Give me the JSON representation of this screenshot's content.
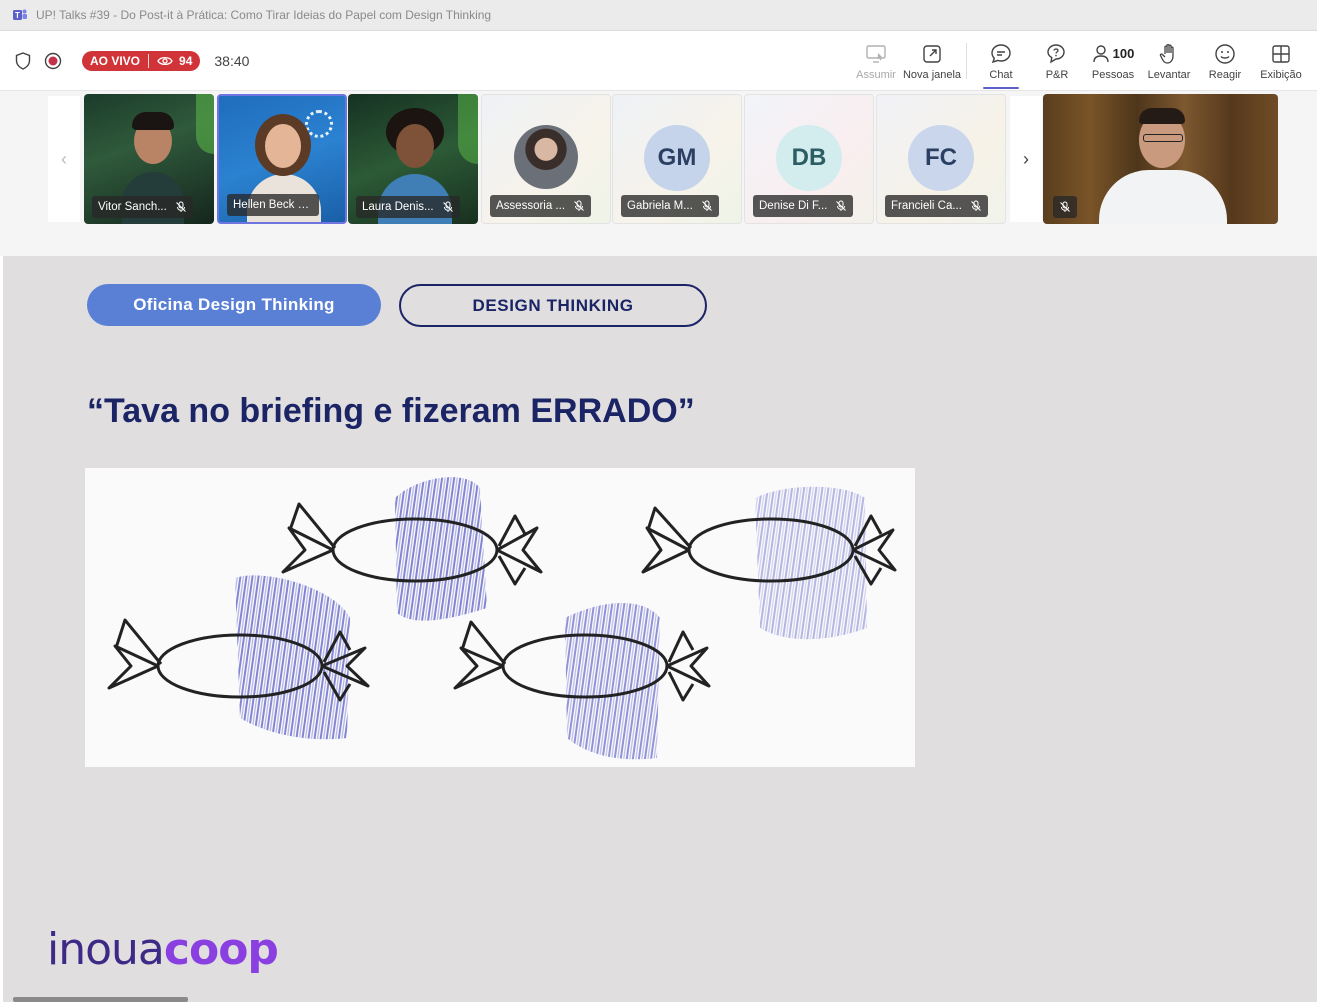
{
  "window": {
    "title": "UP! Talks #39 - Do Post-it à Prática: Como Tirar Ideias do Papel com Design Thinking",
    "app_icon": "teams-icon"
  },
  "toolbar": {
    "live_label": "AO VIVO",
    "viewers": "94",
    "timer": "38:40",
    "buttons": {
      "assumir": "Assumir",
      "nova_janela": "Nova janela",
      "chat": "Chat",
      "qa": "P&R",
      "people": "Pessoas",
      "people_count": "100",
      "raise": "Levantar",
      "react": "Reagir",
      "view": "Exibição"
    }
  },
  "participants": [
    {
      "name": "Vitor Sanch...",
      "type": "video"
    },
    {
      "name": "Hellen Beck De ...",
      "type": "video",
      "highlighted": true
    },
    {
      "name": "Laura Denis...",
      "type": "video"
    },
    {
      "name": "Assessoria ...",
      "type": "photo"
    },
    {
      "name": "Gabriela M...",
      "type": "initials",
      "initials": "GM"
    },
    {
      "name": "Denise Di F...",
      "type": "initials",
      "initials": "DB"
    },
    {
      "name": "Francieli Ca...",
      "type": "initials",
      "initials": "FC"
    }
  ],
  "slide": {
    "tag_primary": "Oficina Design Thinking",
    "tag_secondary": "DESIGN THINKING",
    "title": "“Tava no briefing e fizeram ERRADO”",
    "logo_part1": "inoua",
    "logo_part2": "coop"
  },
  "colors": {
    "accent": "#5b5fc7",
    "live": "#d13438",
    "slide_bg": "#e1dedf",
    "navy": "#1b2566",
    "pill_blue": "#5a80d6",
    "scribble": "#4a4fc0"
  }
}
